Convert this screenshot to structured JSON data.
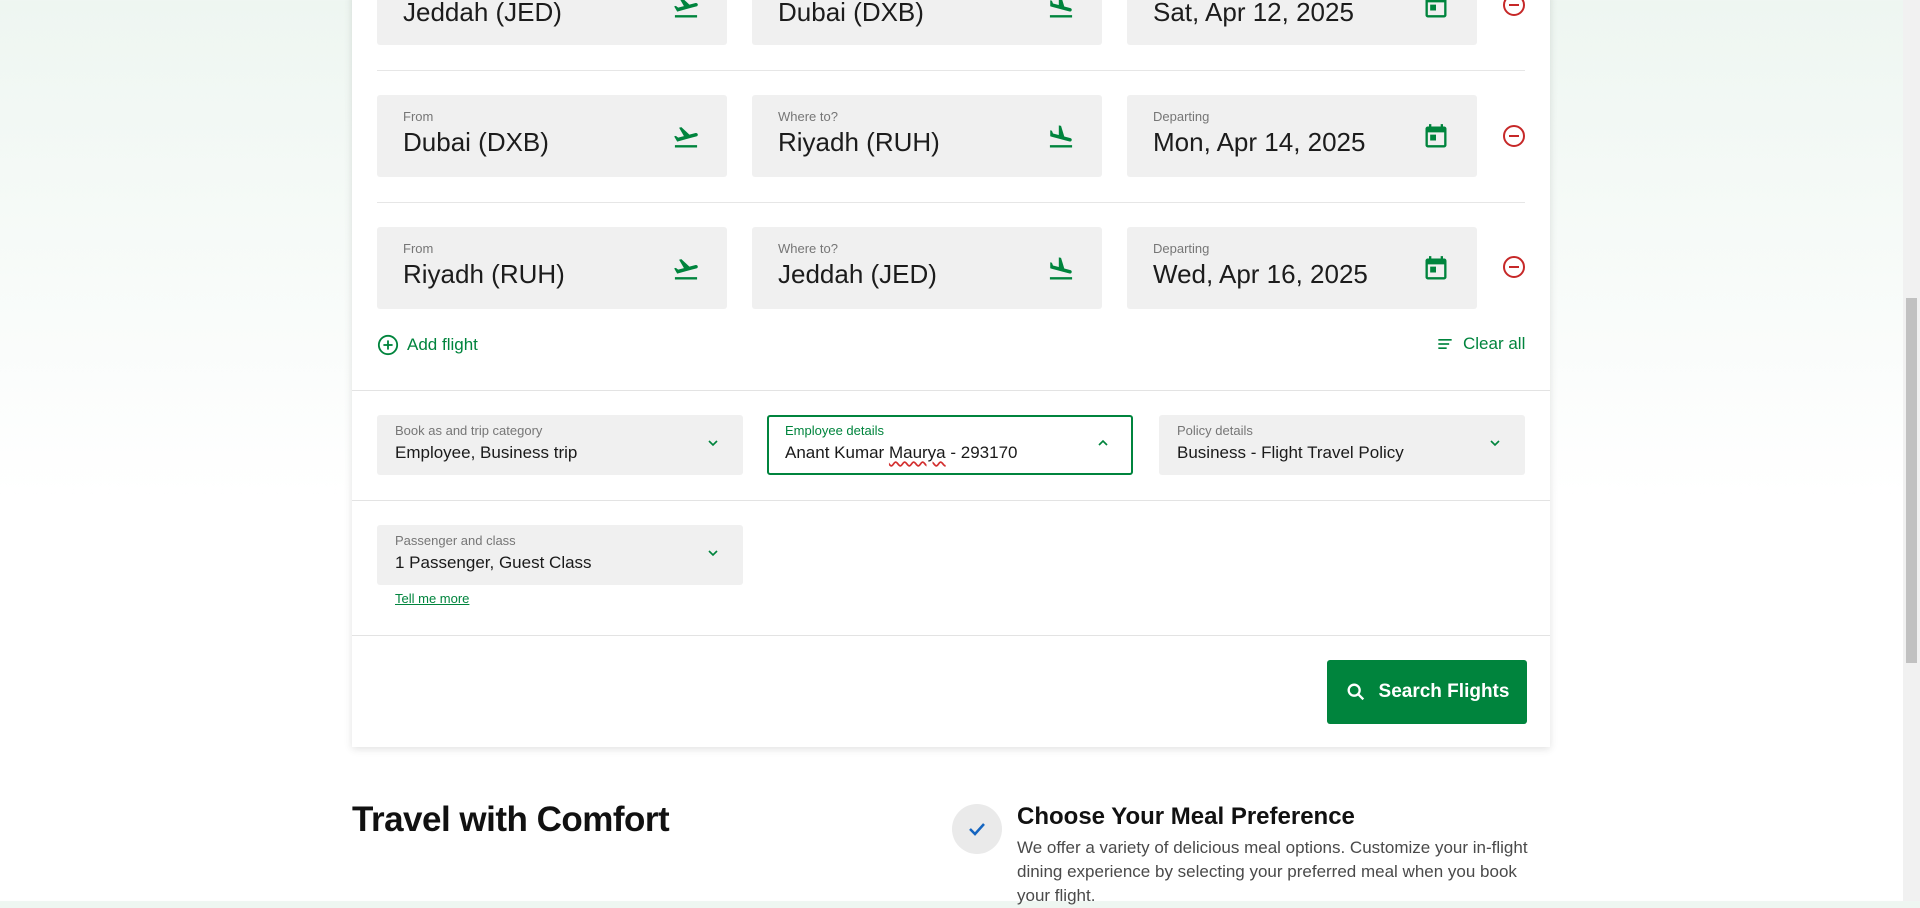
{
  "flights": [
    {
      "from_label": "",
      "from": "Jeddah (JED)",
      "to_label": "",
      "to": "Dubai (DXB)",
      "date_label": "",
      "date": "Sat, Apr 12, 2025"
    },
    {
      "from_label": "From",
      "from": "Dubai (DXB)",
      "to_label": "Where to?",
      "to": "Riyadh (RUH)",
      "date_label": "Departing",
      "date": "Mon, Apr 14, 2025"
    },
    {
      "from_label": "From",
      "from": "Riyadh (RUH)",
      "to_label": "Where to?",
      "to": "Jeddah (JED)",
      "date_label": "Departing",
      "date": "Wed, Apr 16, 2025"
    }
  ],
  "actions": {
    "add_flight": "Add flight",
    "clear_all": "Clear all"
  },
  "booking": {
    "book_as_label": "Book as and trip category",
    "book_as_value": "Employee, Business trip",
    "employee_label": "Employee details",
    "employee_name_first": "Anant Kumar ",
    "employee_name_misspelled": "Maurya",
    "employee_name_rest": " - 293170",
    "policy_label": "Policy details",
    "policy_value": "Business - Flight Travel Policy"
  },
  "passenger": {
    "label": "Passenger and class",
    "value": "1 Passenger, Guest Class",
    "tell_more": "Tell me more"
  },
  "search_button": "Search Flights",
  "promo": {
    "section_title": "Travel with Comfort",
    "feature_title": "Choose Your Meal Preference",
    "feature_desc": "We offer a variety of delicious meal options. Customize your in-flight dining experience by selecting your preferred meal when you book your flight."
  },
  "colors": {
    "brand_green": "#00843d",
    "remove_red": "#c62828",
    "check_blue": "#1565c0"
  },
  "icons": {
    "from": "plane-takeoff-icon",
    "to": "plane-landing-icon",
    "date": "calendar-icon",
    "remove": "minus-circle-icon",
    "add": "plus-circle-icon",
    "clear": "clear-lines-icon",
    "search": "search-icon",
    "dropdown": "chevron-down-icon",
    "active_dropdown": "chevron-up-icon",
    "feature": "check-icon"
  }
}
